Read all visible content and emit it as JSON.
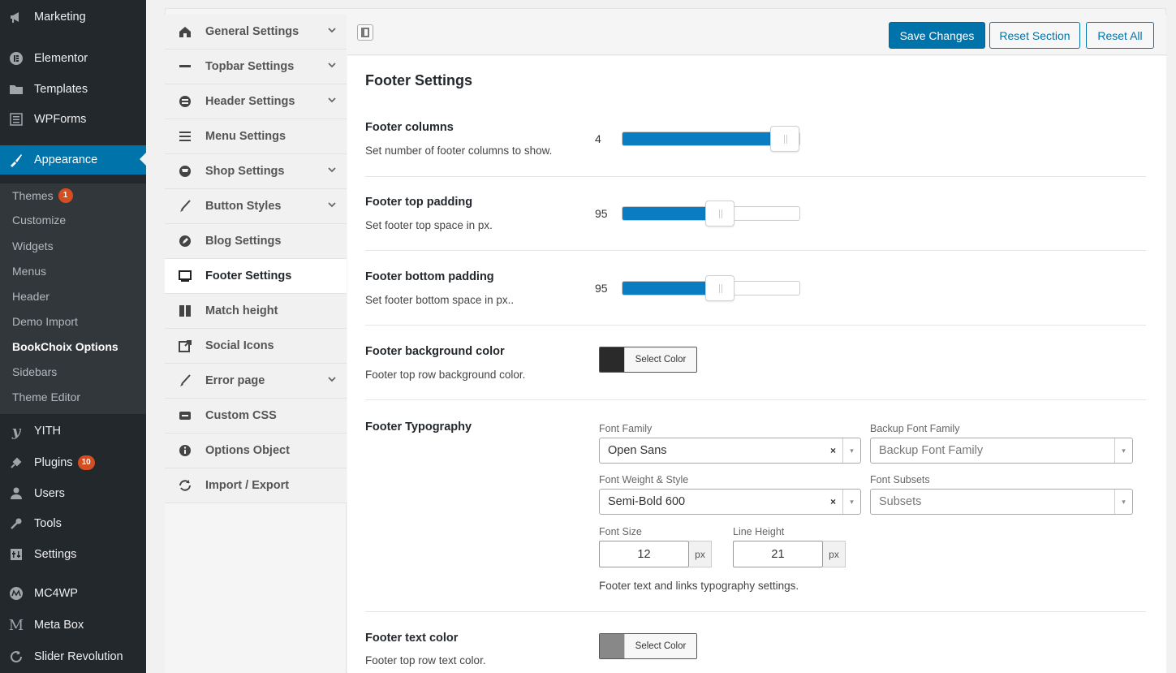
{
  "wp_menu": {
    "marketing": "Marketing",
    "elementor": "Elementor",
    "templates": "Templates",
    "wpforms": "WPForms",
    "appearance": "Appearance",
    "yith": "YITH",
    "plugins": "Plugins",
    "plugins_badge": "10",
    "users": "Users",
    "tools": "Tools",
    "settings": "Settings",
    "mc4wp": "MC4WP",
    "metabox": "Meta Box",
    "slider_revolution": "Slider Revolution"
  },
  "appearance_submenu": {
    "themes": "Themes",
    "themes_badge": "1",
    "customize": "Customize",
    "widgets": "Widgets",
    "menus": "Menus",
    "header": "Header",
    "demo_import": "Demo Import",
    "bookchoix_options": "BookChoix Options",
    "sidebars": "Sidebars",
    "theme_editor": "Theme Editor"
  },
  "options_nav": [
    {
      "label": "General Settings"
    },
    {
      "label": "Topbar Settings"
    },
    {
      "label": "Header Settings"
    },
    {
      "label": "Menu Settings"
    },
    {
      "label": "Shop Settings"
    },
    {
      "label": "Button Styles"
    },
    {
      "label": "Blog Settings"
    },
    {
      "label": "Footer Settings"
    },
    {
      "label": "Match height"
    },
    {
      "label": "Social Icons"
    },
    {
      "label": "Error page"
    },
    {
      "label": "Custom CSS"
    },
    {
      "label": "Options Object"
    },
    {
      "label": "Import / Export"
    }
  ],
  "toolbar": {
    "save": "Save Changes",
    "reset_section": "Reset Section",
    "reset_all": "Reset All"
  },
  "section": {
    "title": "Footer Settings"
  },
  "fields": {
    "columns": {
      "title": "Footer columns",
      "desc": "Set number of footer columns to show.",
      "value": "4",
      "fill_fraction": 1.0
    },
    "top_padding": {
      "title": "Footer top padding",
      "desc": "Set footer top space in px.",
      "value": "95",
      "fill_fraction": 0.56
    },
    "bottom_padding": {
      "title": "Footer bottom padding",
      "desc": "Set footer bottom space in px..",
      "value": "95",
      "fill_fraction": 0.56
    },
    "bg_color": {
      "title": "Footer background color",
      "desc": "Footer top row background color.",
      "button": "Select Color",
      "swatch": "#2a2a2a"
    },
    "typography": {
      "title": "Footer Typography",
      "font_family_label": "Font Family",
      "font_family_value": "Open Sans",
      "backup_label": "Backup Font Family",
      "backup_placeholder": "Backup Font Family",
      "weight_label": "Font Weight & Style",
      "weight_value": "Semi-Bold 600",
      "subsets_label": "Font Subsets",
      "subsets_placeholder": "Subsets",
      "size_label": "Font Size",
      "size_value": "12",
      "size_unit": "px",
      "line_height_label": "Line Height",
      "line_height_value": "21",
      "line_height_unit": "px",
      "desc": "Footer text and links typography settings.",
      "clear_glyph": "×",
      "arrow_glyph": "▾"
    },
    "text_color": {
      "title": "Footer text color",
      "desc": "Footer top row text color.",
      "button": "Select Color",
      "swatch": "#888888"
    }
  },
  "colors": {
    "accent": "#0073aa",
    "slider_fill": "#0a7cc2",
    "sidebar_bg": "#23282d"
  }
}
